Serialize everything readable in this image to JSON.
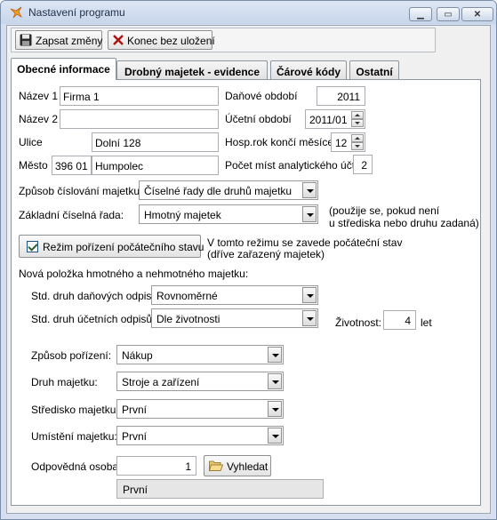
{
  "window": {
    "title": "Nastavení programu"
  },
  "toolbar": {
    "save_label": "Zapsat změny",
    "close_label": "Konec bez uložení"
  },
  "tabs": [
    {
      "label": "Obecné informace",
      "active": true
    },
    {
      "label": "Drobný majetek - evidence",
      "active": false
    },
    {
      "label": "Čárové kódy",
      "active": false
    },
    {
      "label": "Ostatní",
      "active": false
    }
  ],
  "general": {
    "nazev1_label": "Název 1",
    "nazev1_value": "Firma 1",
    "nazev2_label": "Název 2",
    "nazev2_value": "",
    "ulice_label": "Ulice",
    "ulice_value": "Dolní 128",
    "mesto_label": "Město",
    "psc_value": "396 01",
    "mesto_value": "Humpolec",
    "danove_obdobi_label": "Daňové období",
    "danove_obdobi_value": "2011",
    "ucetni_obdobi_label": "Účetní období",
    "ucetni_obdobi_value": "2011/01",
    "hosp_rok_label": "Hosp.rok končí měsícem",
    "hosp_rok_value": "12",
    "pocet_mist_label": "Počet míst analytického účtu",
    "pocet_mist_value": "2"
  },
  "numbering": {
    "zpusob_label": "Způsob číslování majetku",
    "zpusob_value": "Číselné řady dle druhů majetku",
    "zakladni_label": "Základní číselná řada:",
    "zakladni_value": "Hmotný majetek",
    "note_line1": "(použije se, pokud není",
    "note_line2": "u střediska nebo druhu zadaná)"
  },
  "initial_mode": {
    "checkbox_label": "Režim pořízení počátečního stavu",
    "checked": true,
    "note_line1": "V tomto režimu se zavede počáteční stav",
    "note_line2": "(dříve zařazený majetek)"
  },
  "new_item": {
    "heading": "Nová položka hmotného a nehmotného majetku:",
    "danove_label": "Std. druh daňových odpisů",
    "danove_value": "Rovnoměrné",
    "ucetni_label": "Std. druh účetních odpisů",
    "ucetni_value": "Dle životnosti",
    "zivotnost_label": "Životnost:",
    "zivotnost_value": "4",
    "zivotnost_unit": "let",
    "porizeni_label": "Způsob pořízení:",
    "porizeni_value": "Nákup",
    "druh_label": "Druh majetku:",
    "druh_value": "Stroje a zařízení",
    "stredisko_label": "Středisko majetku:",
    "stredisko_value": "První",
    "umisteni_label": "Umístění majetku:",
    "umisteni_value": "První",
    "osoba_label": "Odpovědná osoba:",
    "osoba_value": "1",
    "search_label": "Vyhledat",
    "osoba_name": "První"
  },
  "colors": {
    "title_bar": "#c7d5ea",
    "client_bg": "#f0f0f0",
    "close_x": "#b01010"
  }
}
